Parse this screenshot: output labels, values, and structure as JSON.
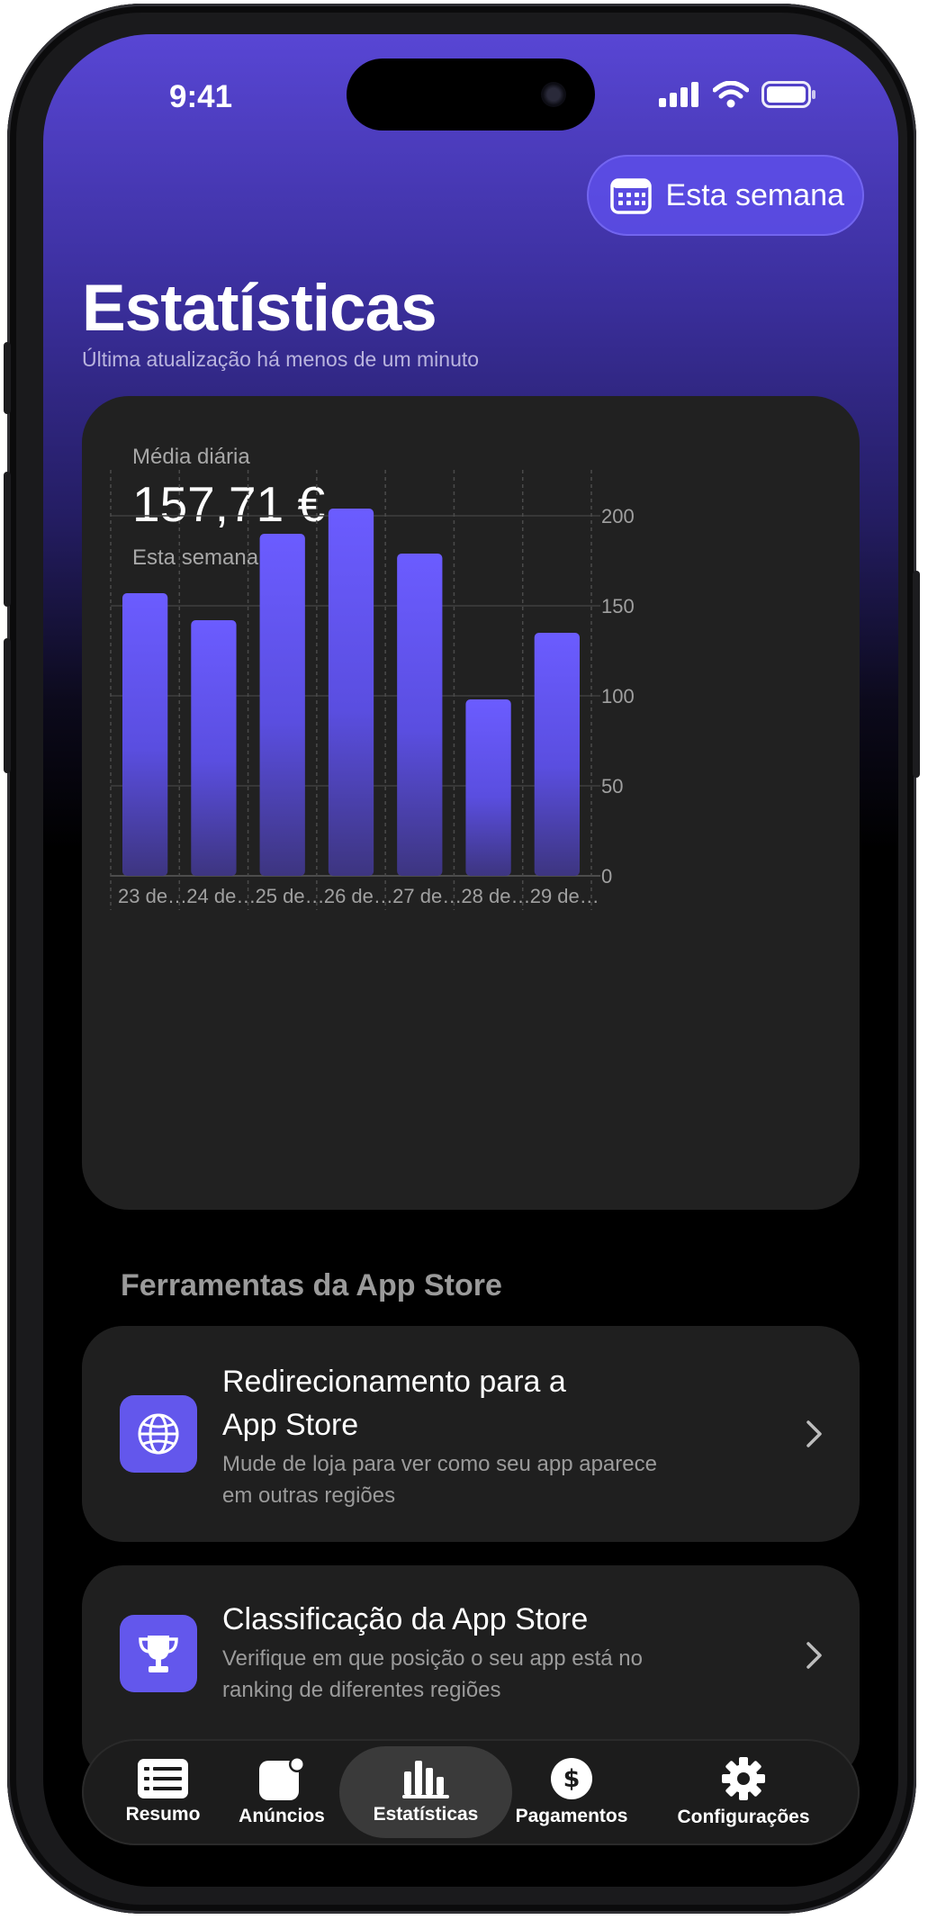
{
  "status_bar": {
    "time": "9:41"
  },
  "header": {
    "period_button_label": "Esta semana",
    "title": "Estatísticas",
    "subtitle": "Última atualização há menos de um minuto"
  },
  "summary_card": {
    "label": "Média diária",
    "value": "157,71 €",
    "period": "Esta semana"
  },
  "chart_data": {
    "type": "bar",
    "categories": [
      "23 de…",
      "24 de…",
      "25 de…",
      "26 de…",
      "27 de…",
      "28 de…",
      "29 de…"
    ],
    "values": [
      157,
      142,
      190,
      204,
      179,
      98,
      135
    ],
    "ylim": [
      0,
      225
    ],
    "yticks": [
      "0",
      "50",
      "100",
      "150",
      "200"
    ],
    "ytick_values": [
      0,
      50,
      100,
      150,
      200
    ],
    "grid": true,
    "bar_color_top": "#6b5cff",
    "bar_color_bottom": "#3d3580"
  },
  "tools": {
    "section_title": "Ferramentas da App Store",
    "items": [
      {
        "title_line1": "Redirecionamento para a",
        "title_line2": "App Store",
        "desc_line1": "Mude de loja para ver como seu app aparece",
        "desc_line2": "em outras regiões",
        "icon": "globe-icon"
      },
      {
        "title_line1": "Classificação da App Store",
        "desc_line1": "Verifique em que posição o seu app está no",
        "desc_line2": "ranking de diferentes regiões",
        "icon": "trophy-icon"
      }
    ]
  },
  "tabbar": {
    "items": [
      {
        "label": "Resumo",
        "icon": "list-icon"
      },
      {
        "label": "Anúncios",
        "icon": "app-badge-icon"
      },
      {
        "label": "Estatísticas",
        "icon": "chart-icon",
        "active": true
      },
      {
        "label": "Pagamentos",
        "icon": "dollar-icon"
      },
      {
        "label": "Configurações",
        "icon": "gear-icon"
      }
    ]
  },
  "colors": {
    "accent": "#6357ec",
    "card": "#212121",
    "header_purple": "#5846d4"
  }
}
